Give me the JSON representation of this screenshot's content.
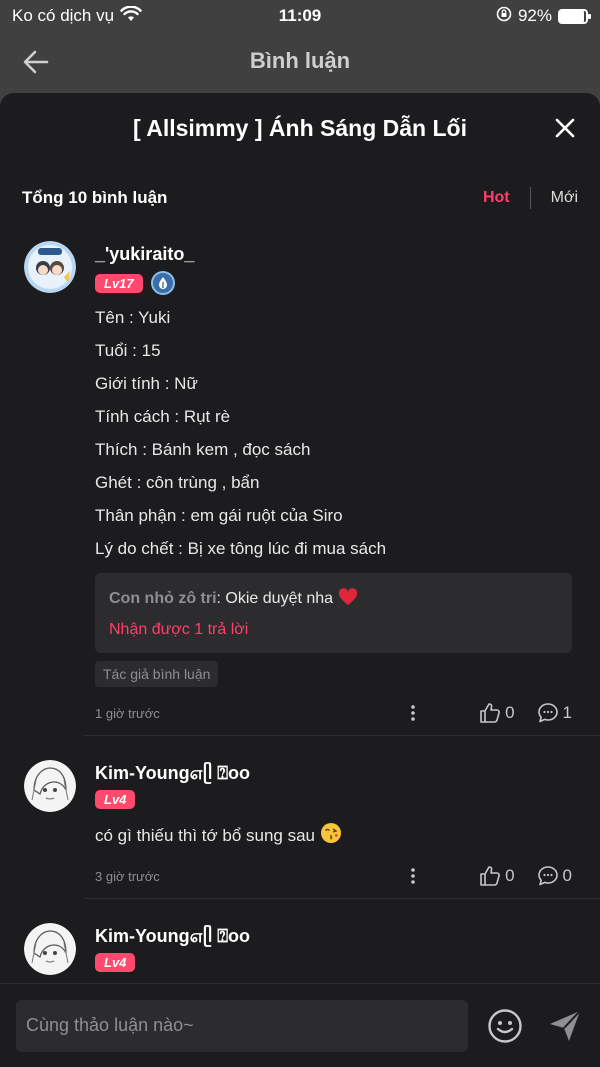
{
  "status_bar": {
    "carrier": "Ko có dịch vụ",
    "time": "11:09",
    "battery_pct": "92%",
    "battery_level": 0.92
  },
  "nav": {
    "title": "Bình luận",
    "back_icon": "arrow-left-icon"
  },
  "sheet": {
    "title": "[ Allsimmy ] Ánh Sáng Dẫn Lối",
    "close_icon": "close-icon",
    "total_label": "Tổng 10 bình luận",
    "sort_tabs": [
      {
        "label": "Hot",
        "active": true
      },
      {
        "label": "Mới",
        "active": false
      }
    ]
  },
  "comments": [
    {
      "username": "_'yukiraito_",
      "level": "Lv17",
      "has_writer_badge": true,
      "lines": [
        "Tên : Yuki",
        "Tuổi : 15",
        "Giới tính : Nữ",
        "Tính cách : Rụt rè",
        "Thích : Bánh kem , đọc sách",
        "Ghét : côn trùng , bẩn",
        "Thân phận : em gái ruột của Siro",
        "Lý do chết : Bị xe tông lúc đi mua sách"
      ],
      "reply": {
        "author": "Con nhỏ zô tri",
        "separator": ":",
        "text": " Okie duyệt nha",
        "emoji": "heart",
        "count_label": "Nhận được 1 trả lời"
      },
      "author_tag": "Tác giả bình luận",
      "time": "1 giờ trước",
      "likes": "0",
      "replies": "1"
    },
    {
      "username": "Kim-Young௭ᥫ ⍰oo",
      "level": "Lv4",
      "lines": [
        "có gì thiếu thì tớ bổ sung sau"
      ],
      "emoji": "kiss-face",
      "time": "3 giờ trước",
      "likes": "0",
      "replies": "0"
    },
    {
      "username": "Kim-Young௭ᥫ ⍰oo",
      "level": "Lv4"
    }
  ],
  "input": {
    "placeholder": "Cùng thảo luận nào~",
    "emoji_icon": "smiley-icon",
    "send_icon": "send-icon"
  },
  "colors": {
    "accent": "#ff3f6b",
    "level_badge": "#ff4a6e",
    "sheet_bg": "#1c1c1e",
    "overlay_bg": "#404040"
  }
}
